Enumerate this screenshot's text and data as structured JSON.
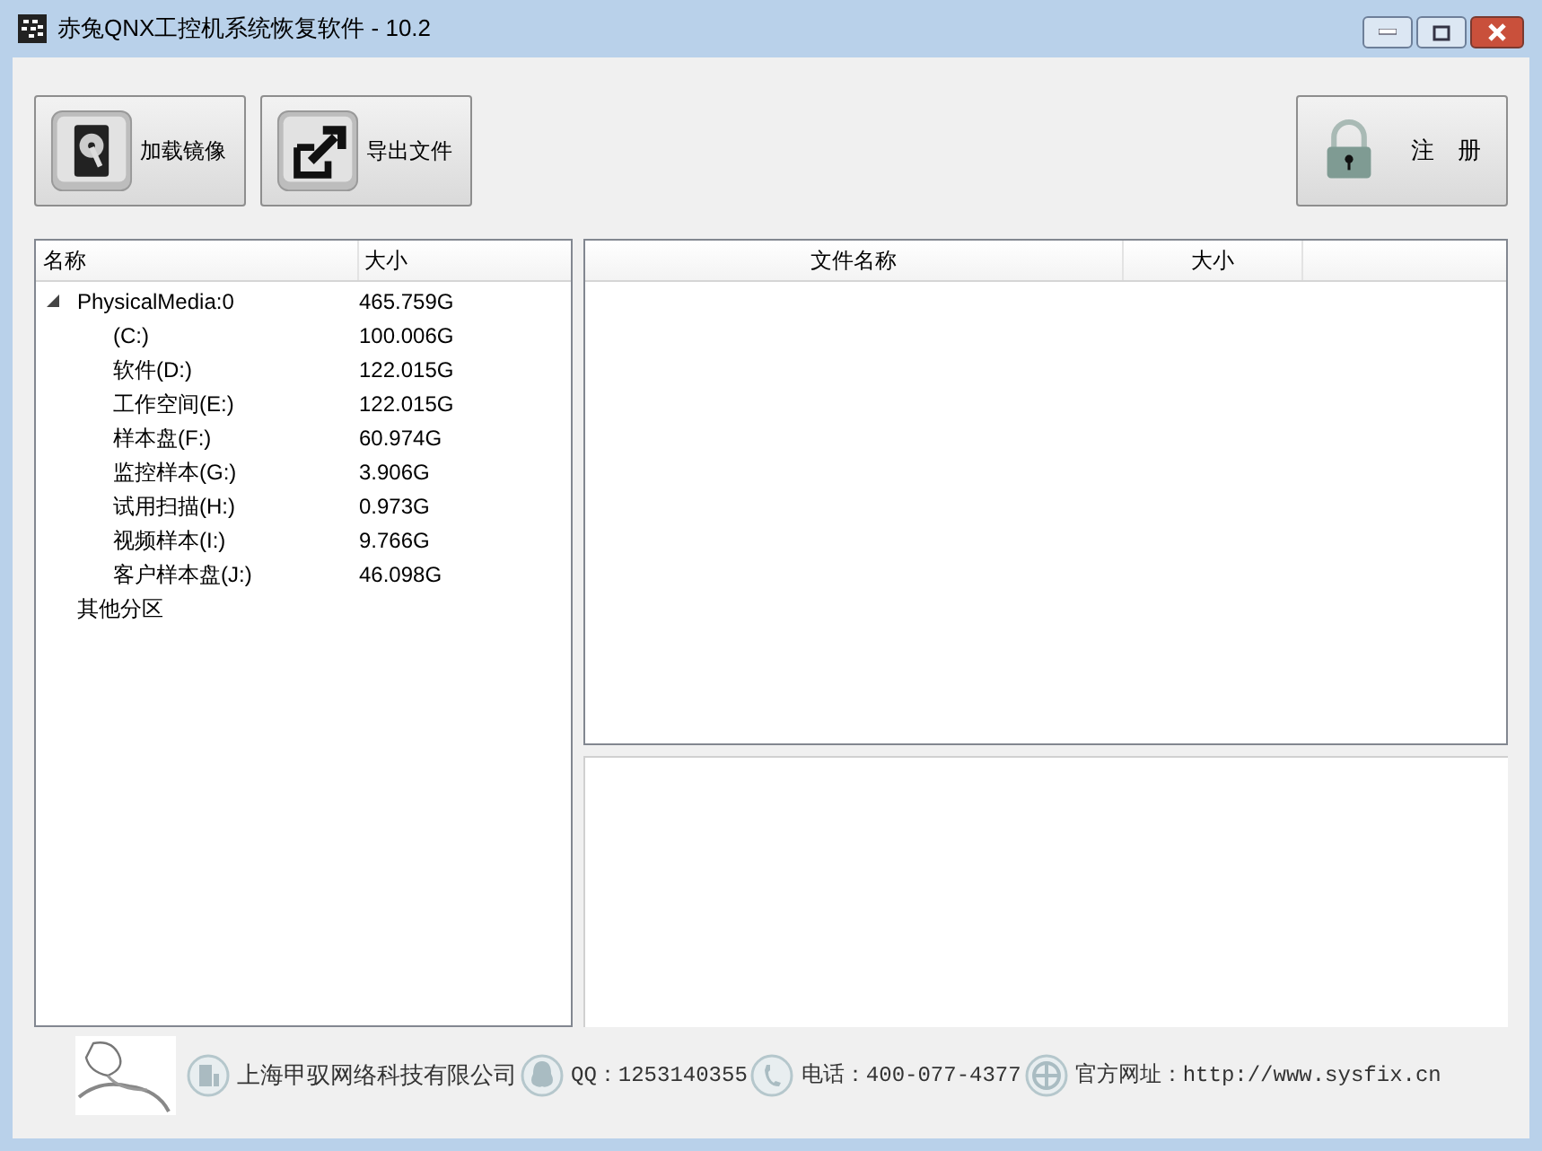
{
  "window": {
    "title": "赤兔QNX工控机系统恢复软件 - 10.2"
  },
  "toolbar": [
    {
      "kind": "disk",
      "label": "加载镜像"
    },
    {
      "kind": "export",
      "label": "导出文件"
    }
  ],
  "register_button": {
    "label": "注　册"
  },
  "tree": {
    "columns": [
      "名称",
      "大小"
    ],
    "items": [
      {
        "name": "PhysicalMedia:0",
        "size": "465.759G",
        "expanded": true,
        "children": [
          {
            "name": "(C:)",
            "size": "100.006G"
          },
          {
            "name": "软件(D:)",
            "size": "122.015G"
          },
          {
            "name": "工作空间(E:)",
            "size": "122.015G"
          },
          {
            "name": "样本盘(F:)",
            "size": "60.974G"
          },
          {
            "name": "监控样本(G:)",
            "size": "3.906G"
          },
          {
            "name": "试用扫描(H:)",
            "size": "0.973G"
          },
          {
            "name": "视频样本(I:)",
            "size": "9.766G"
          },
          {
            "name": "客户样本盘(J:)",
            "size": "46.098G"
          }
        ]
      },
      {
        "name": "其他分区"
      }
    ]
  },
  "file_table": {
    "columns": [
      "文件名称",
      "大小"
    ]
  },
  "footer": [
    {
      "kind": "company",
      "text": "上海甲驭网络科技有限公司"
    },
    {
      "kind": "qq",
      "text": "QQ：1253140355"
    },
    {
      "kind": "phone",
      "text": "电话：400-077-4377"
    },
    {
      "kind": "web",
      "text": "官方网址：http://www.sysfix.cn"
    }
  ]
}
